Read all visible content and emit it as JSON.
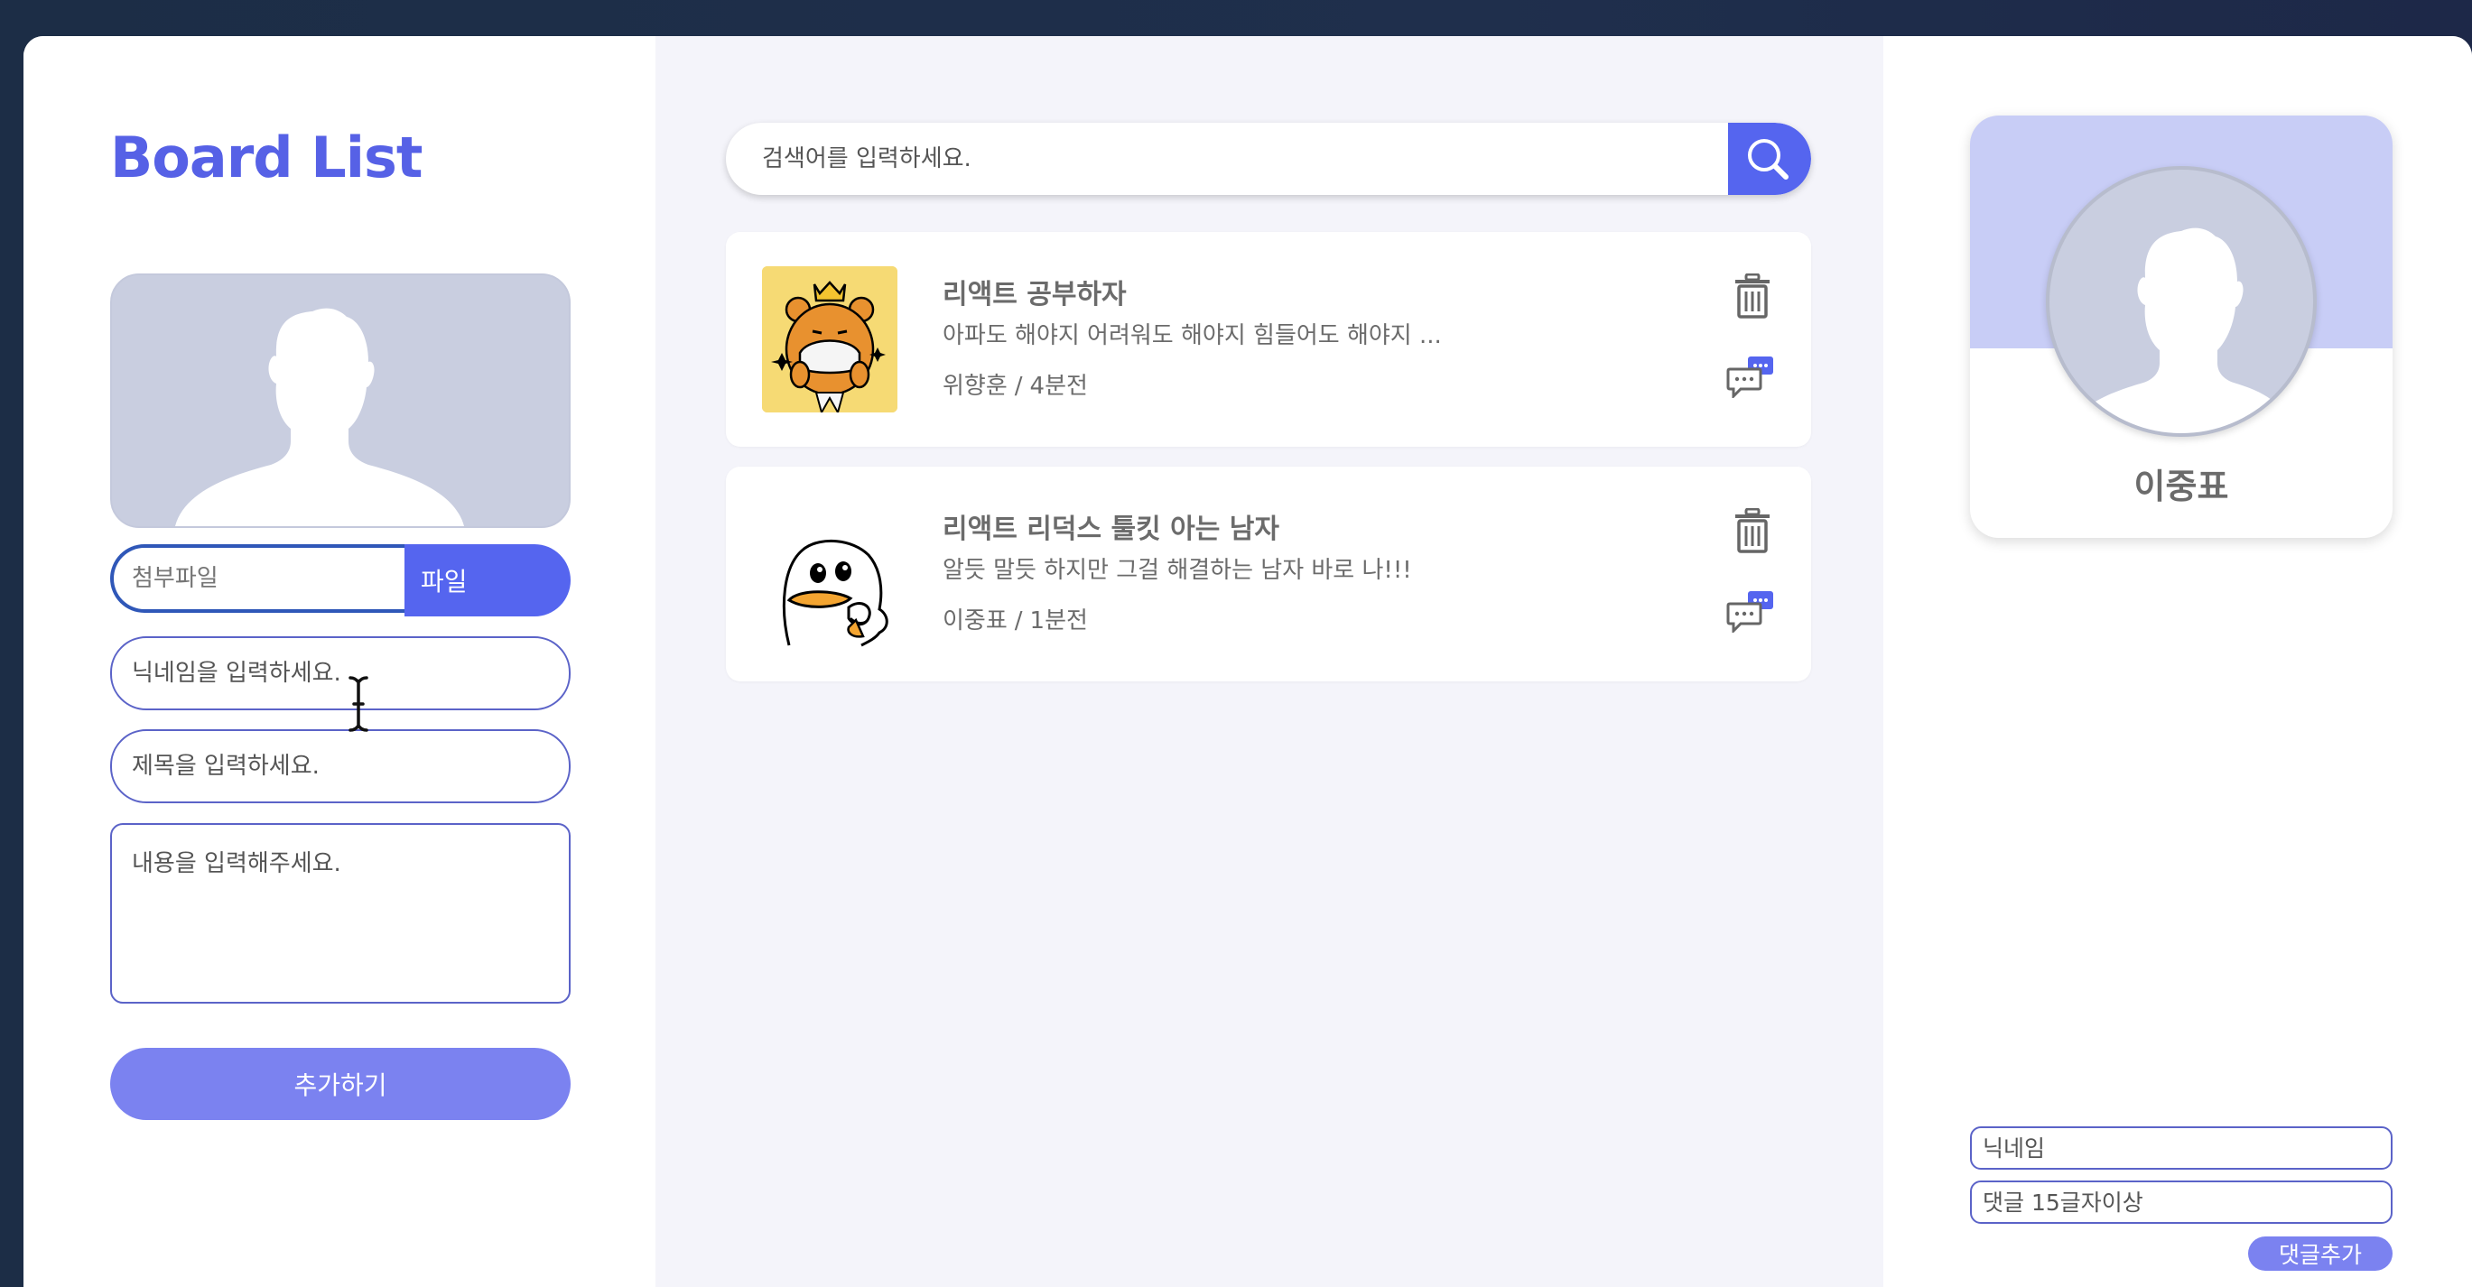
{
  "app": {
    "title": "Board List"
  },
  "form": {
    "file_placeholder": "첨부파일",
    "file_button": "파일",
    "nickname_placeholder": "닉네임을 입력하세요.",
    "title_placeholder": "제목을 입력하세요.",
    "content_placeholder": "내용을 입력해주세요.",
    "submit_label": "추가하기"
  },
  "search": {
    "placeholder": "검색어를 입력하세요."
  },
  "posts": [
    {
      "title": "리액트 공부하자",
      "content": "아파도 해야지 어려워도 해야지 힘들어도 해야지 ...",
      "author": "위향훈",
      "time": "4분전",
      "thumbnail": "bear-character"
    },
    {
      "title": "리액트 리덕스 툴킷 아는 남자",
      "content": "알듯 말듯 하지만 그걸 해결하는 남자 바로 나!!!",
      "author": "이중표",
      "time": "1분전",
      "thumbnail": "duck-character"
    }
  ],
  "meta_separator": "/",
  "profile": {
    "name": "이중표"
  },
  "comment_form": {
    "nickname_placeholder": "닉네임",
    "comment_placeholder": "댓글 15글자이상",
    "submit_label": "댓글추가"
  },
  "colors": {
    "accent": "#5565ef",
    "accent_light": "#7b82f0",
    "title": "#5661e6",
    "profile_header": "#c8cdf6"
  }
}
